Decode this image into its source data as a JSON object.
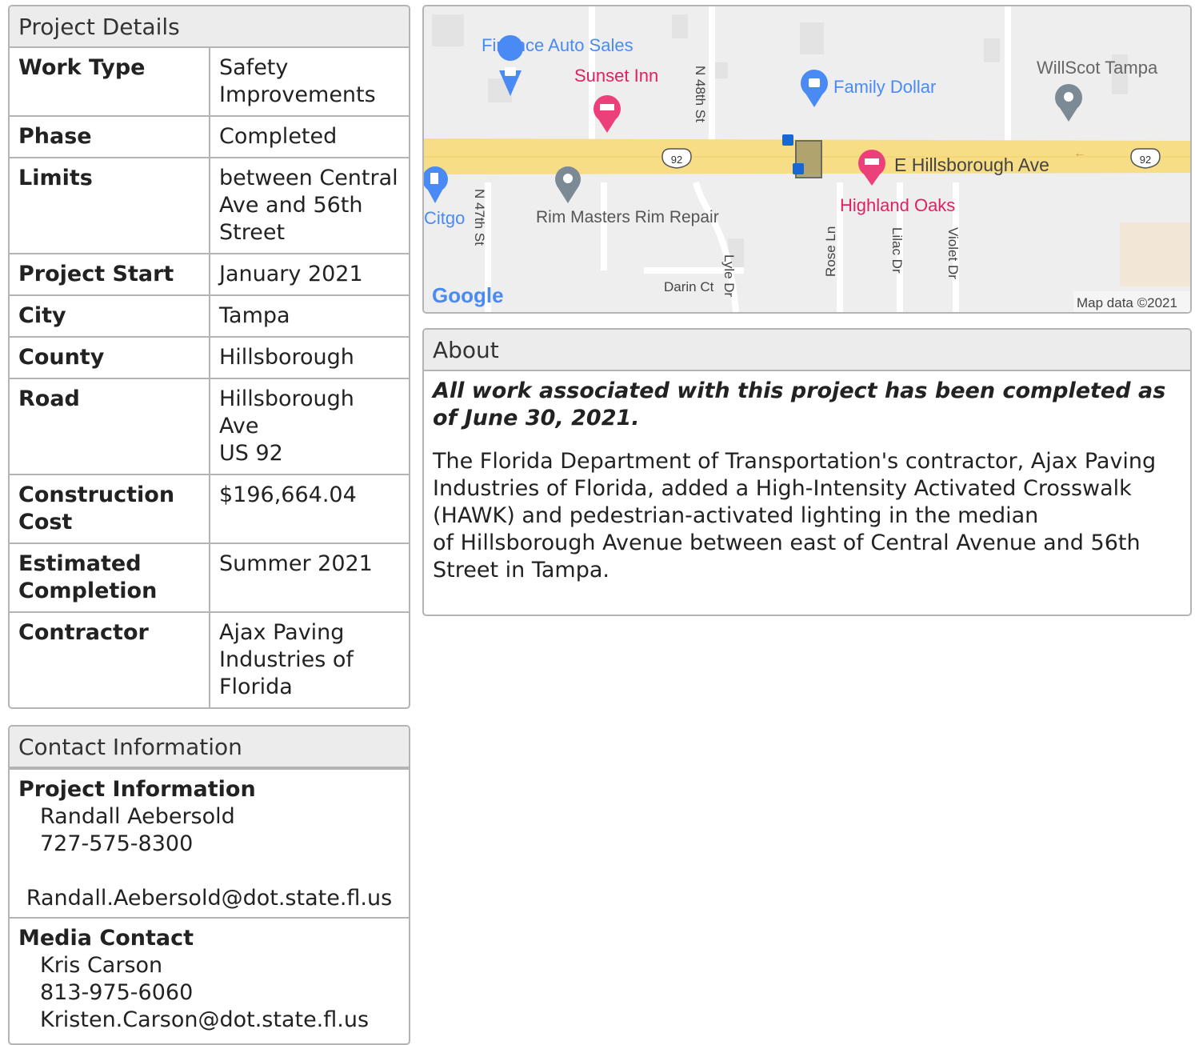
{
  "details": {
    "title": "Project Details",
    "rows": [
      {
        "key": "Work Type",
        "value": "Safety\nImprovements"
      },
      {
        "key": "Phase",
        "value": "Completed"
      },
      {
        "key": "Limits",
        "value": "between Central\nAve and 56th\nStreet"
      },
      {
        "key": "Project Start",
        "value": "January 2021"
      },
      {
        "key": "City",
        "value": "Tampa"
      },
      {
        "key": "County",
        "value": "Hillsborough"
      },
      {
        "key": "Road",
        "value": "Hillsborough\nAve\nUS 92"
      },
      {
        "key": "Construction\nCost",
        "value": "$196,664.04"
      },
      {
        "key": "Estimated\nCompletion",
        "value": "Summer 2021"
      },
      {
        "key": "Contractor",
        "value": "Ajax Paving\nIndustries of\nFlorida"
      }
    ]
  },
  "contact": {
    "title": "Contact Information",
    "project": {
      "label": "Project Information",
      "name": "Randall Aebersold",
      "phone": "727-575-8300",
      "email": "Randall.Aebersold@dot.state.fl.us"
    },
    "media": {
      "label": "Media Contact",
      "name": "Kris Carson",
      "phone": "813-975-6060",
      "email": "Kristen.Carson@dot.state.fl.us"
    }
  },
  "map": {
    "labels": {
      "finance": "Finance Auto Sales",
      "sunset": "Sunset Inn",
      "n48": "N 48th St",
      "family_dollar": "Family Dollar",
      "willscot": "WillScot Tampa",
      "route1": "92",
      "route2": "92",
      "hillsborough": "E Hillsborough Ave",
      "highland": "Highland Oaks",
      "citgo": "Citgo",
      "n47": "N 47th St",
      "rim": "Rim Masters Rim Repair",
      "rose": "Rose Ln",
      "lilac": "Lilac Dr",
      "violet": "Violet Dr",
      "lyle": "Lyle Dr",
      "darin": "Darin Ct",
      "google": "Google",
      "mapdata": "Map data ©2021"
    },
    "colors": {
      "road_major": "#f7dd86",
      "poi_blue": "#4a8af4",
      "poi_pink": "#ec407a",
      "poi_gray": "#7b8a94"
    }
  },
  "about": {
    "title": "About",
    "emphasis": "All work associated with this project has been completed as of June 30, 2021.",
    "body": "The Florida Department of Transportation's contractor, Ajax Paving\nIndustries of Florida, added a High-Intensity Activated Crosswalk\n(HAWK) and pedestrian-activated lighting in the median\nof Hillsborough Avenue between east of Central Avenue and 56th\nStreet in Tampa."
  }
}
